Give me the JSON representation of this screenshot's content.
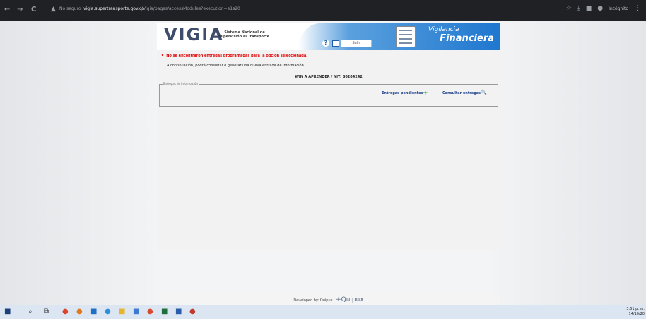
{
  "browser": {
    "back": "←",
    "forward": "→",
    "reload": "C",
    "security_label": "No seguro",
    "url_host": "vigia.supertransporte.gov.co",
    "url_path": "/Vigia/pages/accessModules?execution=e1s20",
    "incognito_label": "Incógnito"
  },
  "header": {
    "logo": "VIGIA",
    "logo_subtitle": "Sistema Nacional de Supervisión al Transporte.",
    "exit_label": "Salir",
    "banner_line1": "Vigilancia",
    "banner_line2": "Financiera"
  },
  "content": {
    "error_message": "No se encontraron entregas programadas para la opción seleccionada.",
    "intro_text": "A continuación, podrá consultar o generar una nueva entrada de información.",
    "company_line": "WIN A APRENDER / NIT: 80204242",
    "fieldset_legend": "Entregas de información",
    "pending_link": "Entregas pendientes",
    "consult_link": "Consultar entregas"
  },
  "footer": {
    "developed_by": "Developed by: Quipux",
    "brand": "Quipux"
  },
  "taskbar": {
    "time": "3:51 p. m.",
    "date": "14/10/20"
  },
  "colors": {
    "banner_blue": "#1f77cf",
    "error_red": "#e00000",
    "link_blue": "#1a3f8c"
  }
}
